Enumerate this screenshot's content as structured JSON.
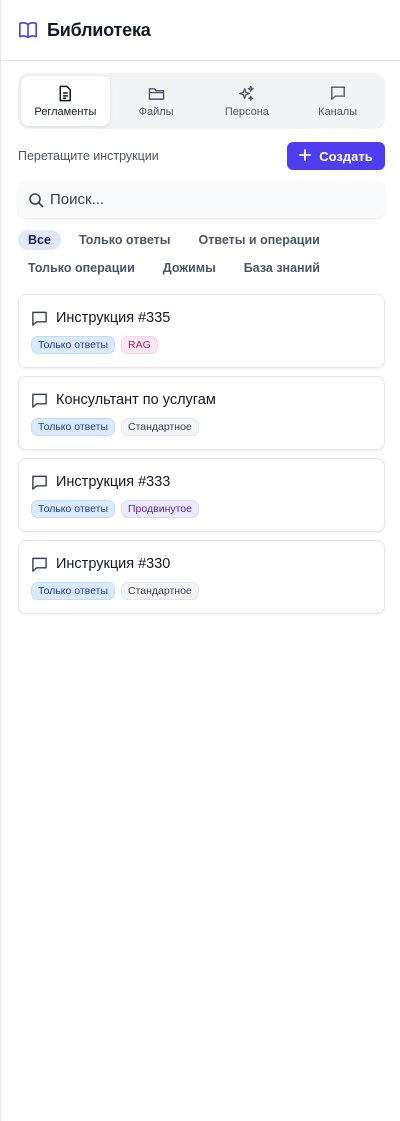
{
  "header": {
    "title": "Библиотека",
    "icon": "book-open-icon",
    "icon_color": "#4f3df0"
  },
  "tabs": [
    {
      "label": "Регламенты",
      "icon": "document-icon",
      "active": true
    },
    {
      "label": "Файлы",
      "icon": "folder-icon",
      "active": false
    },
    {
      "label": "Персона",
      "icon": "sparkles-icon",
      "active": false
    },
    {
      "label": "Каналы",
      "icon": "chat-icon",
      "active": false
    }
  ],
  "actions": {
    "hint": "Перетащите инструкции",
    "create_label": "Создать",
    "create_color": "#4f3df0"
  },
  "search": {
    "placeholder": "Поиск...",
    "value": ""
  },
  "filters": [
    {
      "label": "Все",
      "active": true
    },
    {
      "label": "Только ответы",
      "active": false
    },
    {
      "label": "Ответы и операции",
      "active": false
    },
    {
      "label": "Только операции",
      "active": false
    },
    {
      "label": "Дожимы",
      "active": false
    },
    {
      "label": "База знаний",
      "active": false
    }
  ],
  "cards": [
    {
      "title": "Инструкция #335",
      "badges": [
        {
          "label": "Только ответы",
          "color": "blue"
        },
        {
          "label": "RAG",
          "color": "pink"
        }
      ]
    },
    {
      "title": "Консультант по услугам",
      "badges": [
        {
          "label": "Только ответы",
          "color": "blue"
        },
        {
          "label": "Стандартное",
          "color": "gray"
        }
      ]
    },
    {
      "title": "Инструкция #333",
      "badges": [
        {
          "label": "Только ответы",
          "color": "blue"
        },
        {
          "label": "Продвинутое",
          "color": "violet"
        }
      ]
    },
    {
      "title": "Инструкция #330",
      "badges": [
        {
          "label": "Только ответы",
          "color": "blue"
        },
        {
          "label": "Стандартное",
          "color": "gray"
        }
      ]
    }
  ]
}
